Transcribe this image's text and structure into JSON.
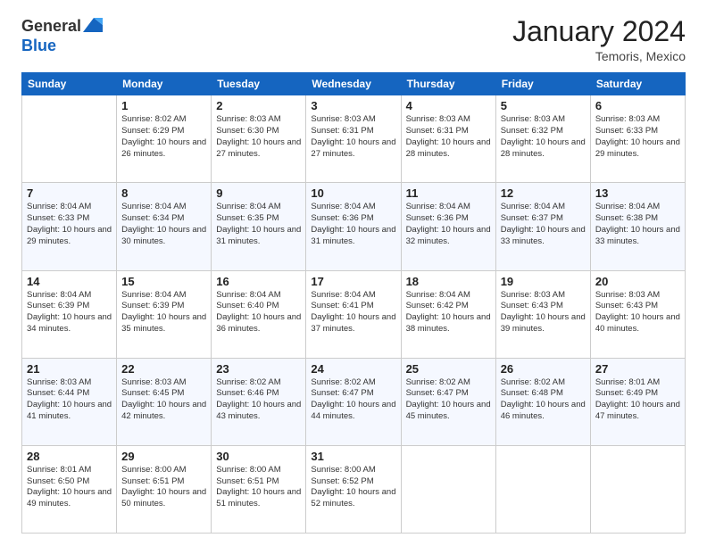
{
  "header": {
    "logo_general": "General",
    "logo_blue": "Blue",
    "month_year": "January 2024",
    "location": "Temoris, Mexico"
  },
  "days_of_week": [
    "Sunday",
    "Monday",
    "Tuesday",
    "Wednesday",
    "Thursday",
    "Friday",
    "Saturday"
  ],
  "weeks": [
    [
      {
        "day": "",
        "sunrise": "",
        "sunset": "",
        "daylight": ""
      },
      {
        "day": "1",
        "sunrise": "Sunrise: 8:02 AM",
        "sunset": "Sunset: 6:29 PM",
        "daylight": "Daylight: 10 hours and 26 minutes."
      },
      {
        "day": "2",
        "sunrise": "Sunrise: 8:03 AM",
        "sunset": "Sunset: 6:30 PM",
        "daylight": "Daylight: 10 hours and 27 minutes."
      },
      {
        "day": "3",
        "sunrise": "Sunrise: 8:03 AM",
        "sunset": "Sunset: 6:31 PM",
        "daylight": "Daylight: 10 hours and 27 minutes."
      },
      {
        "day": "4",
        "sunrise": "Sunrise: 8:03 AM",
        "sunset": "Sunset: 6:31 PM",
        "daylight": "Daylight: 10 hours and 28 minutes."
      },
      {
        "day": "5",
        "sunrise": "Sunrise: 8:03 AM",
        "sunset": "Sunset: 6:32 PM",
        "daylight": "Daylight: 10 hours and 28 minutes."
      },
      {
        "day": "6",
        "sunrise": "Sunrise: 8:03 AM",
        "sunset": "Sunset: 6:33 PM",
        "daylight": "Daylight: 10 hours and 29 minutes."
      }
    ],
    [
      {
        "day": "7",
        "sunrise": "Sunrise: 8:04 AM",
        "sunset": "Sunset: 6:33 PM",
        "daylight": "Daylight: 10 hours and 29 minutes."
      },
      {
        "day": "8",
        "sunrise": "Sunrise: 8:04 AM",
        "sunset": "Sunset: 6:34 PM",
        "daylight": "Daylight: 10 hours and 30 minutes."
      },
      {
        "day": "9",
        "sunrise": "Sunrise: 8:04 AM",
        "sunset": "Sunset: 6:35 PM",
        "daylight": "Daylight: 10 hours and 31 minutes."
      },
      {
        "day": "10",
        "sunrise": "Sunrise: 8:04 AM",
        "sunset": "Sunset: 6:36 PM",
        "daylight": "Daylight: 10 hours and 31 minutes."
      },
      {
        "day": "11",
        "sunrise": "Sunrise: 8:04 AM",
        "sunset": "Sunset: 6:36 PM",
        "daylight": "Daylight: 10 hours and 32 minutes."
      },
      {
        "day": "12",
        "sunrise": "Sunrise: 8:04 AM",
        "sunset": "Sunset: 6:37 PM",
        "daylight": "Daylight: 10 hours and 33 minutes."
      },
      {
        "day": "13",
        "sunrise": "Sunrise: 8:04 AM",
        "sunset": "Sunset: 6:38 PM",
        "daylight": "Daylight: 10 hours and 33 minutes."
      }
    ],
    [
      {
        "day": "14",
        "sunrise": "Sunrise: 8:04 AM",
        "sunset": "Sunset: 6:39 PM",
        "daylight": "Daylight: 10 hours and 34 minutes."
      },
      {
        "day": "15",
        "sunrise": "Sunrise: 8:04 AM",
        "sunset": "Sunset: 6:39 PM",
        "daylight": "Daylight: 10 hours and 35 minutes."
      },
      {
        "day": "16",
        "sunrise": "Sunrise: 8:04 AM",
        "sunset": "Sunset: 6:40 PM",
        "daylight": "Daylight: 10 hours and 36 minutes."
      },
      {
        "day": "17",
        "sunrise": "Sunrise: 8:04 AM",
        "sunset": "Sunset: 6:41 PM",
        "daylight": "Daylight: 10 hours and 37 minutes."
      },
      {
        "day": "18",
        "sunrise": "Sunrise: 8:04 AM",
        "sunset": "Sunset: 6:42 PM",
        "daylight": "Daylight: 10 hours and 38 minutes."
      },
      {
        "day": "19",
        "sunrise": "Sunrise: 8:03 AM",
        "sunset": "Sunset: 6:43 PM",
        "daylight": "Daylight: 10 hours and 39 minutes."
      },
      {
        "day": "20",
        "sunrise": "Sunrise: 8:03 AM",
        "sunset": "Sunset: 6:43 PM",
        "daylight": "Daylight: 10 hours and 40 minutes."
      }
    ],
    [
      {
        "day": "21",
        "sunrise": "Sunrise: 8:03 AM",
        "sunset": "Sunset: 6:44 PM",
        "daylight": "Daylight: 10 hours and 41 minutes."
      },
      {
        "day": "22",
        "sunrise": "Sunrise: 8:03 AM",
        "sunset": "Sunset: 6:45 PM",
        "daylight": "Daylight: 10 hours and 42 minutes."
      },
      {
        "day": "23",
        "sunrise": "Sunrise: 8:02 AM",
        "sunset": "Sunset: 6:46 PM",
        "daylight": "Daylight: 10 hours and 43 minutes."
      },
      {
        "day": "24",
        "sunrise": "Sunrise: 8:02 AM",
        "sunset": "Sunset: 6:47 PM",
        "daylight": "Daylight: 10 hours and 44 minutes."
      },
      {
        "day": "25",
        "sunrise": "Sunrise: 8:02 AM",
        "sunset": "Sunset: 6:47 PM",
        "daylight": "Daylight: 10 hours and 45 minutes."
      },
      {
        "day": "26",
        "sunrise": "Sunrise: 8:02 AM",
        "sunset": "Sunset: 6:48 PM",
        "daylight": "Daylight: 10 hours and 46 minutes."
      },
      {
        "day": "27",
        "sunrise": "Sunrise: 8:01 AM",
        "sunset": "Sunset: 6:49 PM",
        "daylight": "Daylight: 10 hours and 47 minutes."
      }
    ],
    [
      {
        "day": "28",
        "sunrise": "Sunrise: 8:01 AM",
        "sunset": "Sunset: 6:50 PM",
        "daylight": "Daylight: 10 hours and 49 minutes."
      },
      {
        "day": "29",
        "sunrise": "Sunrise: 8:00 AM",
        "sunset": "Sunset: 6:51 PM",
        "daylight": "Daylight: 10 hours and 50 minutes."
      },
      {
        "day": "30",
        "sunrise": "Sunrise: 8:00 AM",
        "sunset": "Sunset: 6:51 PM",
        "daylight": "Daylight: 10 hours and 51 minutes."
      },
      {
        "day": "31",
        "sunrise": "Sunrise: 8:00 AM",
        "sunset": "Sunset: 6:52 PM",
        "daylight": "Daylight: 10 hours and 52 minutes."
      },
      {
        "day": "",
        "sunrise": "",
        "sunset": "",
        "daylight": ""
      },
      {
        "day": "",
        "sunrise": "",
        "sunset": "",
        "daylight": ""
      },
      {
        "day": "",
        "sunrise": "",
        "sunset": "",
        "daylight": ""
      }
    ]
  ]
}
